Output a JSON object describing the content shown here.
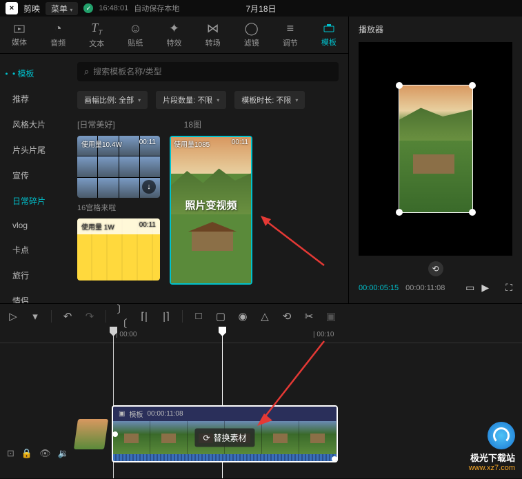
{
  "app": {
    "logo_text": "×",
    "name": "剪映",
    "menu": "菜单",
    "autosave_time": "16:48:01",
    "autosave_text": "自动保存本地",
    "project_title": "7月18日"
  },
  "tabs": [
    {
      "label": "媒体",
      "icon": "▶"
    },
    {
      "label": "音频",
      "icon": "◔"
    },
    {
      "label": "文本",
      "icon": "T"
    },
    {
      "label": "贴纸",
      "icon": "☺"
    },
    {
      "label": "特效",
      "icon": "✦"
    },
    {
      "label": "转场",
      "icon": "⋈"
    },
    {
      "label": "滤镜",
      "icon": "◯"
    },
    {
      "label": "调节",
      "icon": "⇄"
    },
    {
      "label": "模板",
      "icon": "▭"
    }
  ],
  "sidebar": {
    "items": [
      "模板",
      "推荐",
      "风格大片",
      "片头片尾",
      "宣传",
      "日常碎片",
      "vlog",
      "卡点",
      "旅行",
      "情侣"
    ]
  },
  "search": {
    "placeholder": "搜索模板名称/类型"
  },
  "filters": [
    {
      "label": "画幅比例: 全部"
    },
    {
      "label": "片段数量: 不限"
    },
    {
      "label": "模板时长: 不限"
    }
  ],
  "sections": {
    "a": "[日常美好]",
    "b": "18图"
  },
  "thumbs": {
    "t1": {
      "usage": "使用量10.4W",
      "duration": "00:11",
      "caption": "16宫格来啦"
    },
    "t2": {
      "usage": "使用量1085",
      "duration": "00:11",
      "overlay": "照片变视频"
    },
    "t3": {
      "usage": "使用量 1W",
      "duration": "00:11"
    }
  },
  "player": {
    "title": "播放器",
    "time_current": "00:00:05:15",
    "time_total": "00:00:11:08"
  },
  "clip": {
    "badge": "模板",
    "duration": "00:00:11:08",
    "replace": "替换素材"
  },
  "ruler": {
    "t0": "00:00",
    "t1": "00:10"
  },
  "watermark": {
    "name": "极光下载站",
    "url": "www.xz7.com"
  }
}
